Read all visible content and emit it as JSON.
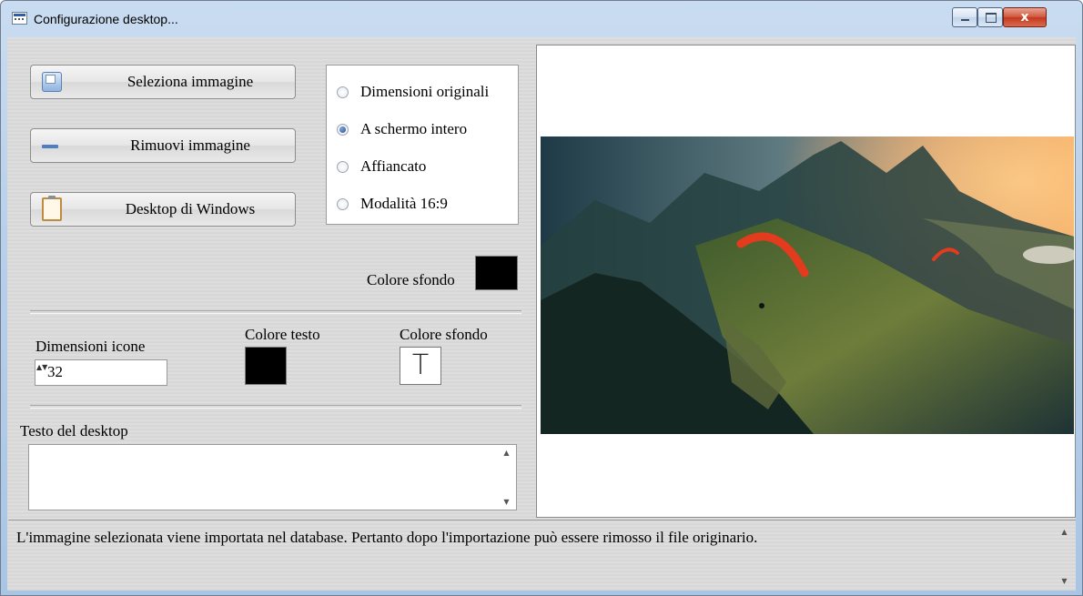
{
  "window": {
    "title": "Configurazione desktop...",
    "controls": {
      "minimize": "minimize",
      "maximize": "maximize",
      "close": "close",
      "close_glyph": "x"
    }
  },
  "buttons": {
    "select_image": "Seleziona immagine",
    "remove_image": "Rimuovi immagine",
    "windows_desktop": "Desktop di Windows"
  },
  "display_mode": {
    "options": [
      {
        "label": "Dimensioni originali",
        "selected": false
      },
      {
        "label": "A schermo intero",
        "selected": true
      },
      {
        "label": "Affiancato",
        "selected": false
      },
      {
        "label": "Modalità 16:9",
        "selected": false
      }
    ]
  },
  "background": {
    "label": "Colore sfondo",
    "color": "#000000"
  },
  "icons": {
    "size_label": "Dimensioni icone",
    "size_value": "32",
    "spinner_arrows": "▲▼",
    "text_color_label": "Colore testo",
    "text_color": "#000000",
    "bg_color_label": "Colore sfondo",
    "bg_color": "transparent",
    "bg_color_glyph": "T"
  },
  "desktop_text": {
    "label": "Testo del desktop",
    "value": ""
  },
  "scroll": {
    "up": "▲",
    "down": "▼"
  },
  "info": "L'immagine selezionata viene importata nel database. Pertanto dopo l'importazione può essere rimosso il file originario."
}
